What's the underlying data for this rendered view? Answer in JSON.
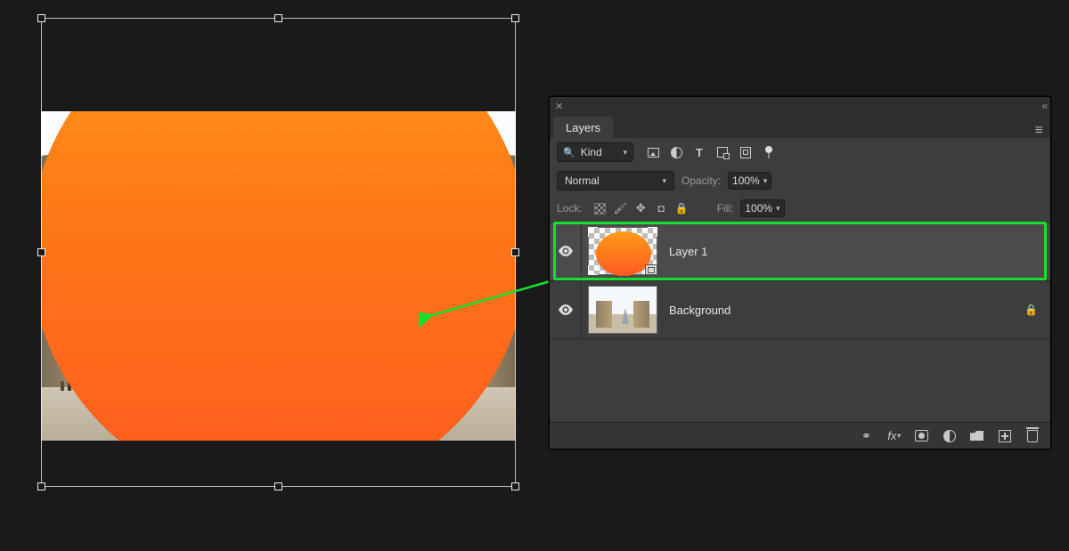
{
  "panel": {
    "title": "Layers",
    "filter_label": "Kind",
    "blend_mode": "Normal",
    "opacity_label": "Opacity:",
    "opacity_value": "100%",
    "lock_label": "Lock:",
    "fill_label": "Fill:",
    "fill_value": "100%"
  },
  "layers": [
    {
      "name": "Layer 1",
      "visible": true,
      "locked": false,
      "selected": true,
      "smart_object": true,
      "kind": "gradient-circle"
    },
    {
      "name": "Background",
      "visible": true,
      "locked": true,
      "selected": false,
      "smart_object": false,
      "kind": "photo"
    }
  ],
  "filter_icons": [
    "pixel",
    "adjustment",
    "type",
    "shape",
    "smart-object",
    "artboard-toggle"
  ],
  "lock_icons": [
    "transparency",
    "brush",
    "position",
    "crop",
    "all"
  ],
  "footer_icons": [
    "link",
    "fx",
    "mask",
    "adjust",
    "group",
    "new",
    "delete"
  ]
}
